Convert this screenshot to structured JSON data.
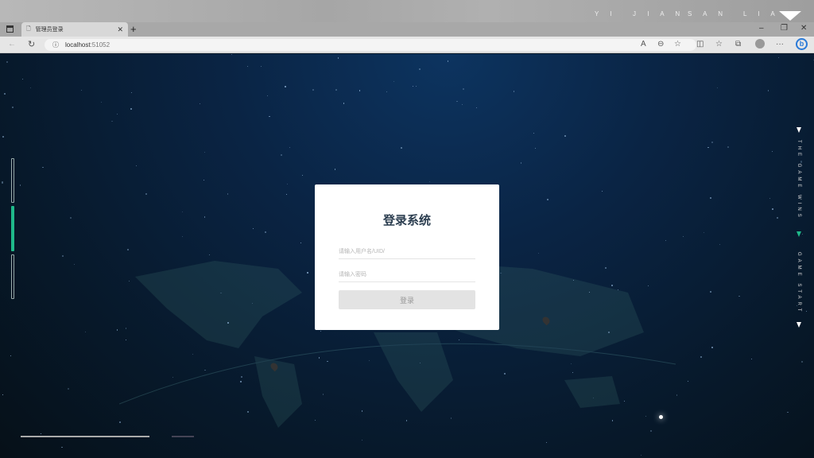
{
  "browser": {
    "tab_title": "管理员登录",
    "url_host": "localhost",
    "url_port": ":51052"
  },
  "banner": {
    "letters": [
      "Y I",
      "J I A N",
      "S A N",
      "L I A"
    ]
  },
  "login": {
    "title": "登录系统",
    "username_placeholder": "请输入用户名/UID/",
    "password_placeholder": "请输入密码",
    "submit_label": "登录"
  },
  "side_nav": {
    "items": [
      "THE GAME WINS",
      "GAME START"
    ],
    "active_index": 1,
    "left_active_index": 1
  },
  "colors": {
    "accent": "#1fb98a",
    "title": "#2c3e50"
  }
}
